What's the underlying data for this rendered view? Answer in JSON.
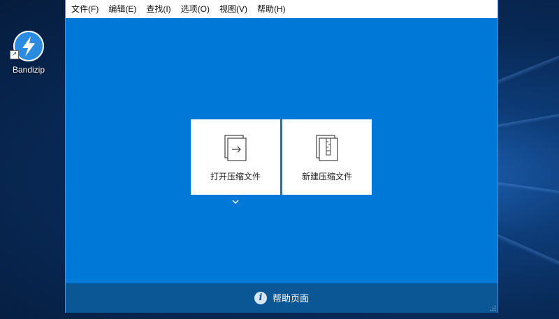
{
  "desktop": {
    "icon_label": "Bandizip"
  },
  "menu": {
    "items": [
      {
        "label": "文件(F)"
      },
      {
        "label": "编辑(E)"
      },
      {
        "label": "查找(I)"
      },
      {
        "label": "选项(O)"
      },
      {
        "label": "视图(V)"
      },
      {
        "label": "帮助(H)"
      }
    ]
  },
  "main": {
    "open_archive_label": "打开压缩文件",
    "new_archive_label": "新建压缩文件"
  },
  "footer": {
    "help_label": "帮助页面"
  },
  "colors": {
    "window_background": "#0078d7",
    "footer_background": "#0b5695",
    "menubar_background": "#ffffff"
  }
}
